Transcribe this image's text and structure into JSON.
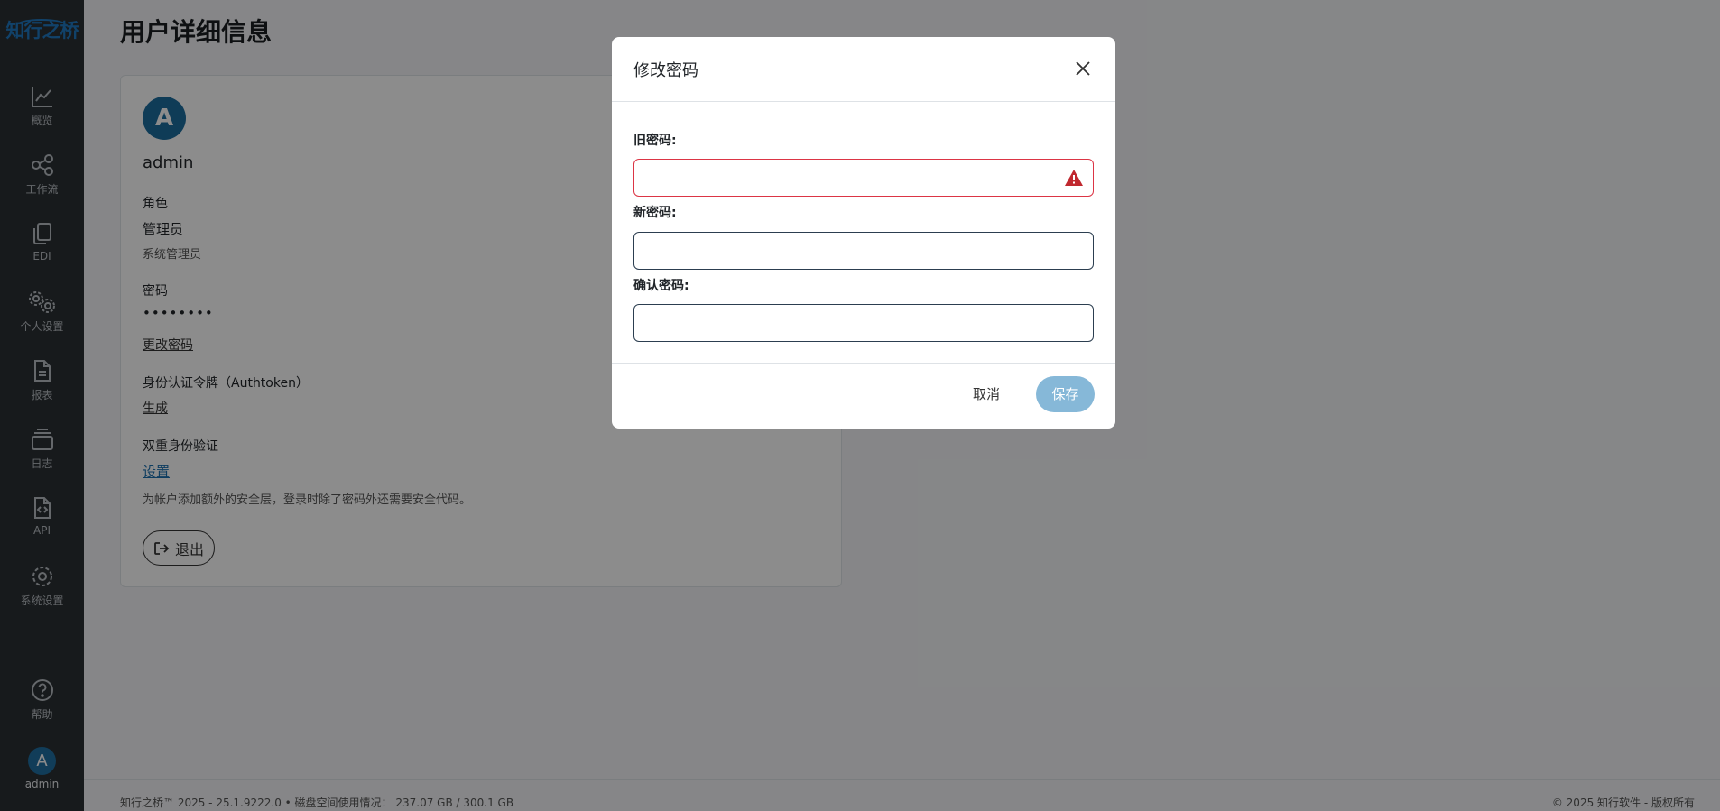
{
  "sidebar": {
    "logo": "知行之桥",
    "items": [
      {
        "label": "概览",
        "icon": "chart-line-icon"
      },
      {
        "label": "工作流",
        "icon": "share-nodes-icon"
      },
      {
        "label": "EDI",
        "icon": "copy-documents-icon"
      },
      {
        "label": "个人设置",
        "icon": "user-gears-icon"
      },
      {
        "label": "报表",
        "icon": "report-file-icon"
      },
      {
        "label": "日志",
        "icon": "layers-log-icon"
      },
      {
        "label": "API",
        "icon": "api-file-code-icon"
      },
      {
        "label": "系统设置",
        "icon": "gear-icon"
      }
    ],
    "help_label": "帮助",
    "user": {
      "initial": "A",
      "name": "admin"
    }
  },
  "page": {
    "title": "用户详细信息",
    "profile": {
      "initial": "A",
      "username": "admin",
      "role_label": "角色",
      "role_value": "管理员",
      "role_description": "系统管理员",
      "password_label": "密码",
      "password_mask": "••••••••",
      "change_password_link": "更改密码",
      "authtoken_label": "身份认证令牌（Authtoken）",
      "generate_link": "生成",
      "twofa_label": "双重身份验证",
      "twofa_setup_link": "设置",
      "twofa_description": "为帐户添加额外的安全层，登录时除了密码外还需要安全代码。",
      "logout_button": "退出"
    }
  },
  "footer": {
    "left": "知行之桥™ 2025 - 25.1.9222.0  •  磁盘空间使用情况： 237.07 GB / 300.1 GB",
    "right": "© 2025 知行软件 - 版权所有"
  },
  "modal": {
    "title": "修改密码",
    "old_password_label": "旧密码:",
    "new_password_label": "新密码:",
    "confirm_password_label": "确认密码:",
    "old_password_value": "",
    "new_password_value": "",
    "confirm_password_value": "",
    "cancel_button": "取消",
    "save_button": "保存"
  },
  "colors": {
    "sidebar_bg": "#2b3033",
    "brand": "#1f78c1",
    "error": "#dc3545",
    "save_disabled": "#86b8d8"
  }
}
